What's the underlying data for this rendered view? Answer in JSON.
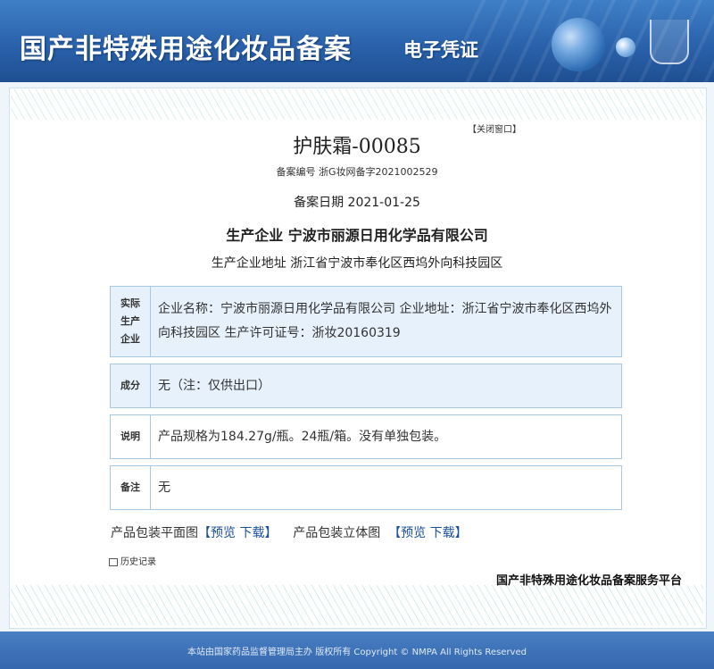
{
  "banner": {
    "title": "国产非特殊用途化妆品备案",
    "subtitle": "电子凭证"
  },
  "record": {
    "close_label": "【关闭窗口】",
    "product_name": "护肤霜-00085",
    "registration_no": "备案编号  浙G妆网备字2021002529",
    "registration_date": "备案日期  2021-01-25",
    "producer": "生产企业  宁波市丽源日用化学品有限公司",
    "producer_address": "生产企业地址  浙江省宁波市奉化区西坞外向科技园区"
  },
  "rows": [
    {
      "label": "实际\n生产\n企业",
      "value": "企业名称：宁波市丽源日用化学品有限公司  企业地址：浙江省宁波市奉化区西坞外向科技园区  生产许可证号：浙妆20160319"
    },
    {
      "label": "成分",
      "value": "无（注：仅供出口）"
    },
    {
      "label": "说明",
      "value": "产品规格为184.27g/瓶。24瓶/箱。没有单独包装。"
    },
    {
      "label": "备注",
      "value": "无"
    }
  ],
  "packaging": {
    "flat_label": "产品包装平面图",
    "flat_preview": "【预览",
    "flat_download": "下载】",
    "solid_label": "产品包装立体图",
    "solid_preview": "【预览",
    "solid_download": "下载】"
  },
  "history_label": "历史记录",
  "platform_label": "国产非特殊用途化妆品备案服务平台",
  "footer": {
    "text": "本站由国家药品监督管理局主办  版权所有 Copyright © NMPA All Rights Reserved"
  },
  "colors": {
    "banner": "#2a62ab",
    "row_shaded": "#e6f1fb",
    "row_border": "#a9c9e2",
    "footer": "#3467ad",
    "link": "#1a4fa0"
  }
}
